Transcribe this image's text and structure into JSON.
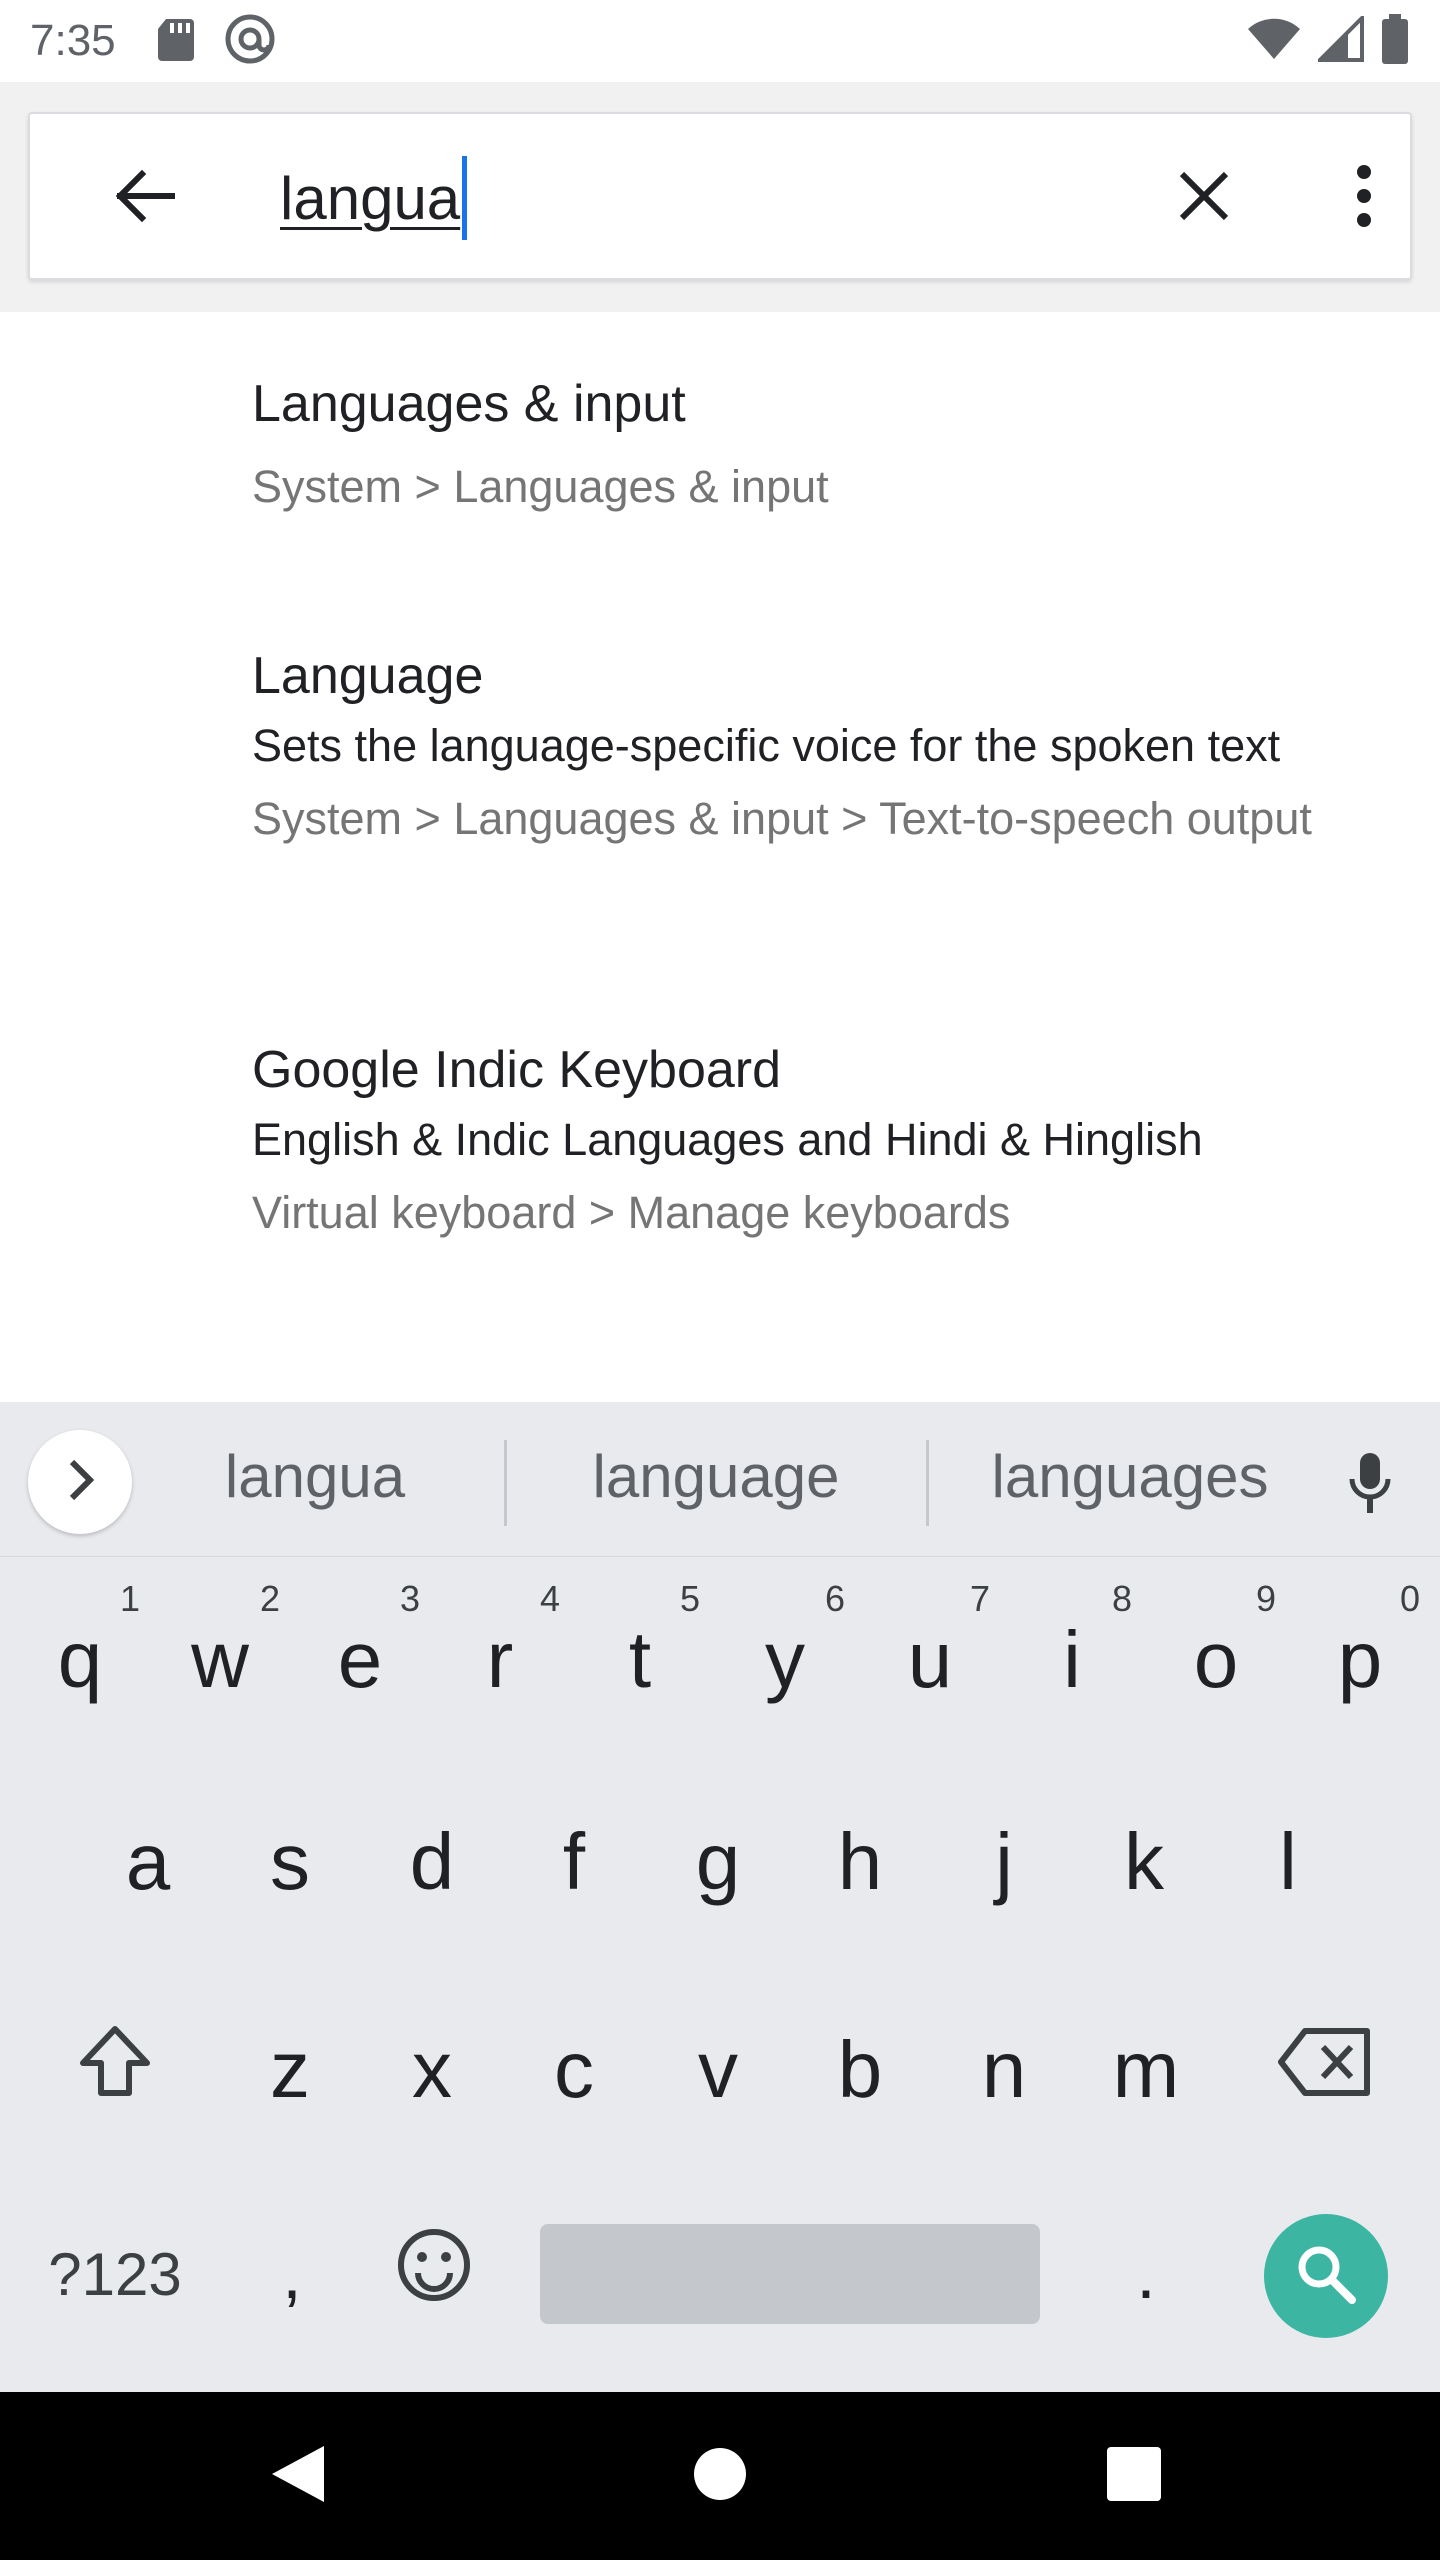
{
  "status_bar": {
    "time": "7:35",
    "left_icons": [
      "sd-card-icon",
      "at-sign-icon"
    ],
    "right_icons": [
      "wifi-icon",
      "cell-signal-icon",
      "battery-icon"
    ]
  },
  "search": {
    "query": "langua",
    "back_icon": "arrow-back-icon",
    "clear_icon": "close-icon",
    "more_icon": "more-vert-icon"
  },
  "results": [
    {
      "title": "Languages & input",
      "summary": "",
      "path": "System > Languages & input"
    },
    {
      "title": "Language",
      "summary": "Sets the language-specific voice for the spoken text",
      "path": "System > Languages & input > Text-to-speech output"
    },
    {
      "title": "Google Indic Keyboard",
      "summary": "English & Indic Languages and Hindi & Hinglish",
      "path": "Virtual keyboard > Manage keyboards"
    }
  ],
  "keyboard": {
    "suggestions": [
      "langua",
      "language",
      "languages"
    ],
    "row1": [
      {
        "label": "q",
        "hint": "1"
      },
      {
        "label": "w",
        "hint": "2"
      },
      {
        "label": "e",
        "hint": "3"
      },
      {
        "label": "r",
        "hint": "4"
      },
      {
        "label": "t",
        "hint": "5"
      },
      {
        "label": "y",
        "hint": "6"
      },
      {
        "label": "u",
        "hint": "7"
      },
      {
        "label": "i",
        "hint": "8"
      },
      {
        "label": "o",
        "hint": "9"
      },
      {
        "label": "p",
        "hint": "0"
      }
    ],
    "row2": [
      "a",
      "s",
      "d",
      "f",
      "g",
      "h",
      "j",
      "k",
      "l"
    ],
    "row3": [
      "z",
      "x",
      "c",
      "v",
      "b",
      "n",
      "m"
    ],
    "symbols_label": "?123",
    "comma_label": ",",
    "period_label": "."
  },
  "colors": {
    "accent": "#1a73e8",
    "search_key": "#3cb5a3",
    "keyboard_bg": "#e8eaed",
    "nav_bar": "#000000"
  }
}
